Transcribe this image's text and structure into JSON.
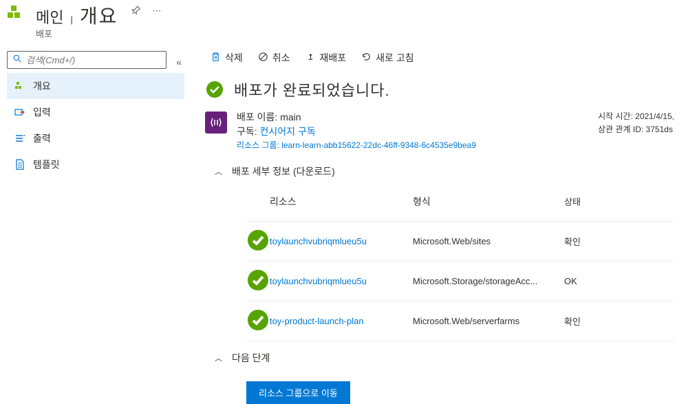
{
  "header": {
    "title_main": "메인",
    "divider": "|",
    "title_page": "개요",
    "subtitle": "배포"
  },
  "search": {
    "placeholder": "검색(Cmd+/)",
    "collapse": "«"
  },
  "nav": {
    "items": [
      {
        "label": "개요",
        "icon": "cube",
        "active": true
      },
      {
        "label": "입력",
        "icon": "input",
        "active": false
      },
      {
        "label": "출력",
        "icon": "output",
        "active": false
      },
      {
        "label": "템플릿",
        "icon": "template",
        "active": false
      }
    ]
  },
  "toolbar": {
    "delete": "삭제",
    "cancel": "취소",
    "redeploy": "재배포",
    "refresh": "새로 고침"
  },
  "status": {
    "text": "배포가 완료되었습니다."
  },
  "detail": {
    "name_label": "배포 이름:",
    "name_value": "main",
    "sub_label": "구독:",
    "sub_value": "컨시어지 구독",
    "rg_label": "리소스 그룹:",
    "rg_value": "learn-learn-abb15622-22dc-46ff-9348-6c4535e9bea9",
    "start_label": "시작 시간:",
    "start_value": "2021/4/15,",
    "corr_label": "상관 관계 ID:",
    "corr_value": "3751ds"
  },
  "sections": {
    "details": "배포 세부 정보",
    "download": "(다운로드)",
    "next": "다음 단계"
  },
  "table": {
    "headers": {
      "resource": "리소스",
      "type": "형식",
      "state": "상태"
    },
    "rows": [
      {
        "resource": "toylaunchvubriqmlueu5u",
        "type": "Microsoft.Web/sites",
        "state": "확인"
      },
      {
        "resource": "toylaunchvubriqmlueu5u",
        "type": "Microsoft.Storage/storageAcc...",
        "state": "OK"
      },
      {
        "resource": "toy-product-launch-plan",
        "type": "Microsoft.Web/serverfarms",
        "state": "확인"
      }
    ]
  },
  "button": {
    "goto_rg": "리소스 그룹으로 이동"
  }
}
